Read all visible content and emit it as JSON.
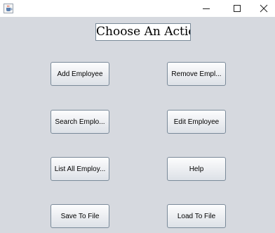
{
  "window": {
    "app_icon": "java-coffee-cup-icon",
    "controls": {
      "minimize": "minimize-icon",
      "maximize": "maximize-icon",
      "close": "close-icon"
    }
  },
  "heading": "Choose An Action",
  "buttons": {
    "add": "Add Employee",
    "remove": "Remove Empl...",
    "search": "Search Emplo...",
    "edit": "Edit Employee",
    "list": "List All Employ...",
    "help": "Help",
    "save": "Save To File",
    "load": "Load To File"
  }
}
